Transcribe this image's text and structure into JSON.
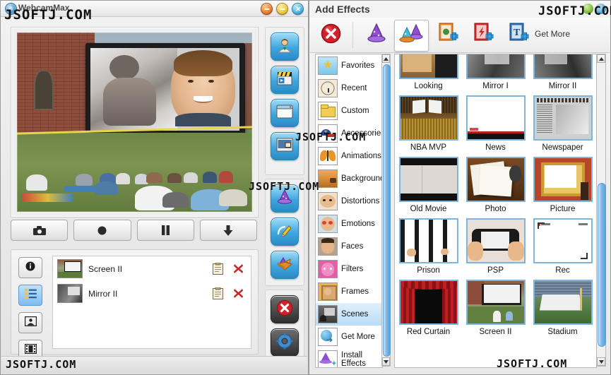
{
  "main_window": {
    "title": "WebcamMax",
    "window_buttons": [
      {
        "name": "minimize",
        "glyph": "–",
        "color": "#e2711c"
      },
      {
        "name": "maximize",
        "glyph": "–",
        "color": "#e8c02a"
      },
      {
        "name": "close",
        "glyph": "✕",
        "color": "#3da5d8"
      }
    ],
    "media_buttons": [
      {
        "name": "snapshot-button",
        "icon": "camera-icon"
      },
      {
        "name": "record-button",
        "icon": "record-icon"
      },
      {
        "name": "pause-button",
        "icon": "pause-icon"
      },
      {
        "name": "save-button",
        "icon": "download-arrow-icon"
      }
    ],
    "mode_buttons": [
      {
        "name": "info-mode",
        "icon": "info-icon",
        "selected": false
      },
      {
        "name": "list-mode",
        "icon": "list-icon",
        "selected": true
      },
      {
        "name": "picture-mode",
        "icon": "picture-icon",
        "selected": false
      },
      {
        "name": "video-mode",
        "icon": "film-icon",
        "selected": false
      }
    ],
    "active_effects": [
      {
        "label": "Screen II",
        "config_icon": "clipboard-icon",
        "delete_icon": "red-x-icon"
      },
      {
        "label": "Mirror II",
        "config_icon": "clipboard-icon",
        "delete_icon": "red-x-icon"
      }
    ],
    "side_tools_group1": [
      {
        "name": "avatar-tool",
        "icon": "person-icon"
      },
      {
        "name": "video-tool",
        "icon": "clapperboard-icon"
      },
      {
        "name": "window-tool",
        "icon": "window-icon"
      },
      {
        "name": "picture-in-picture-tool",
        "icon": "pip-icon"
      }
    ],
    "side_tools_group2": [
      {
        "name": "effects-tool",
        "icon": "wizard-hat-icon"
      },
      {
        "name": "draw-tool",
        "icon": "pencil-icon"
      },
      {
        "name": "package-tool",
        "icon": "open-box-icon"
      }
    ],
    "side_tools_group3": [
      {
        "name": "exit-tool",
        "icon": "red-x-circle-icon"
      },
      {
        "name": "settings-tool",
        "icon": "gear-icon"
      }
    ]
  },
  "effects_window": {
    "title": "Add Effects",
    "get_more_label": "Get More",
    "toolbar": [
      {
        "name": "close-effects-button",
        "icon": "red-x-circle-icon",
        "selected": false
      },
      {
        "name": "single-effect-button",
        "icon": "purple-wizard-hat-icon",
        "selected": false
      },
      {
        "name": "multi-effect-button",
        "icon": "multi-wizard-hat-icon",
        "selected": true
      },
      {
        "name": "add-image-button",
        "icon": "add-image-icon",
        "selected": false
      },
      {
        "name": "add-flash-button",
        "icon": "add-flash-icon",
        "selected": false
      },
      {
        "name": "add-text-button",
        "icon": "add-text-icon",
        "selected": false
      }
    ],
    "categories": [
      {
        "label": "Favorites",
        "icon": "star-icon",
        "selected": false
      },
      {
        "label": "Recent",
        "icon": "clock-icon",
        "selected": false
      },
      {
        "label": "Custom",
        "icon": "folder-icon",
        "selected": false
      },
      {
        "label": "Accessorie",
        "icon": "cap-icon",
        "selected": false
      },
      {
        "label": "Animations",
        "icon": "butterfly-icon",
        "selected": false
      },
      {
        "label": "Background",
        "icon": "desert-icon",
        "selected": false
      },
      {
        "label": "Distortions",
        "icon": "distorted-face-icon",
        "selected": false
      },
      {
        "label": "Emotions",
        "icon": "emotion-face-icon",
        "selected": false
      },
      {
        "label": "Faces",
        "icon": "face-icon",
        "selected": false
      },
      {
        "label": "Filters",
        "icon": "pink-face-icon",
        "selected": false
      },
      {
        "label": "Frames",
        "icon": "frame-icon",
        "selected": false
      },
      {
        "label": "Scenes",
        "icon": "scene-icon",
        "selected": true
      },
      {
        "label": "Get More",
        "icon": "globe-arrow-icon",
        "selected": false
      },
      {
        "label": "Install Effects",
        "icon": "hat-plus-icon",
        "selected": false
      }
    ],
    "effects_grid": [
      [
        {
          "label": "Looking",
          "thumb": "looking"
        },
        {
          "label": "Mirror I",
          "thumb": "mirror1"
        },
        {
          "label": "Mirror II",
          "thumb": "mirror2"
        }
      ],
      [
        {
          "label": "NBA MVP",
          "thumb": "nba"
        },
        {
          "label": "News",
          "thumb": "news"
        },
        {
          "label": "Newspaper",
          "thumb": "newspaper"
        }
      ],
      [
        {
          "label": "Old Movie",
          "thumb": "oldmovie"
        },
        {
          "label": "Photo",
          "thumb": "photo"
        },
        {
          "label": "Picture",
          "thumb": "picture"
        }
      ],
      [
        {
          "label": "Prison",
          "thumb": "prison"
        },
        {
          "label": "PSP",
          "thumb": "psp"
        },
        {
          "label": "Rec",
          "thumb": "rec"
        }
      ],
      [
        {
          "label": "Red Curtain",
          "thumb": "curtain"
        },
        {
          "label": "Screen II",
          "thumb": "screen2"
        },
        {
          "label": "Stadium",
          "thumb": "stadium"
        }
      ]
    ]
  },
  "watermarks": {
    "top_left": "JSOFTJ.COM",
    "top_right": "JSOFTJ.COM",
    "mid_left": "JSOFTJ.COM",
    "sidebar": "JSOFTJ.COM",
    "bottom_left": "JSOFTJ.COM",
    "bottom_right": "JSOFTJ.COM"
  }
}
